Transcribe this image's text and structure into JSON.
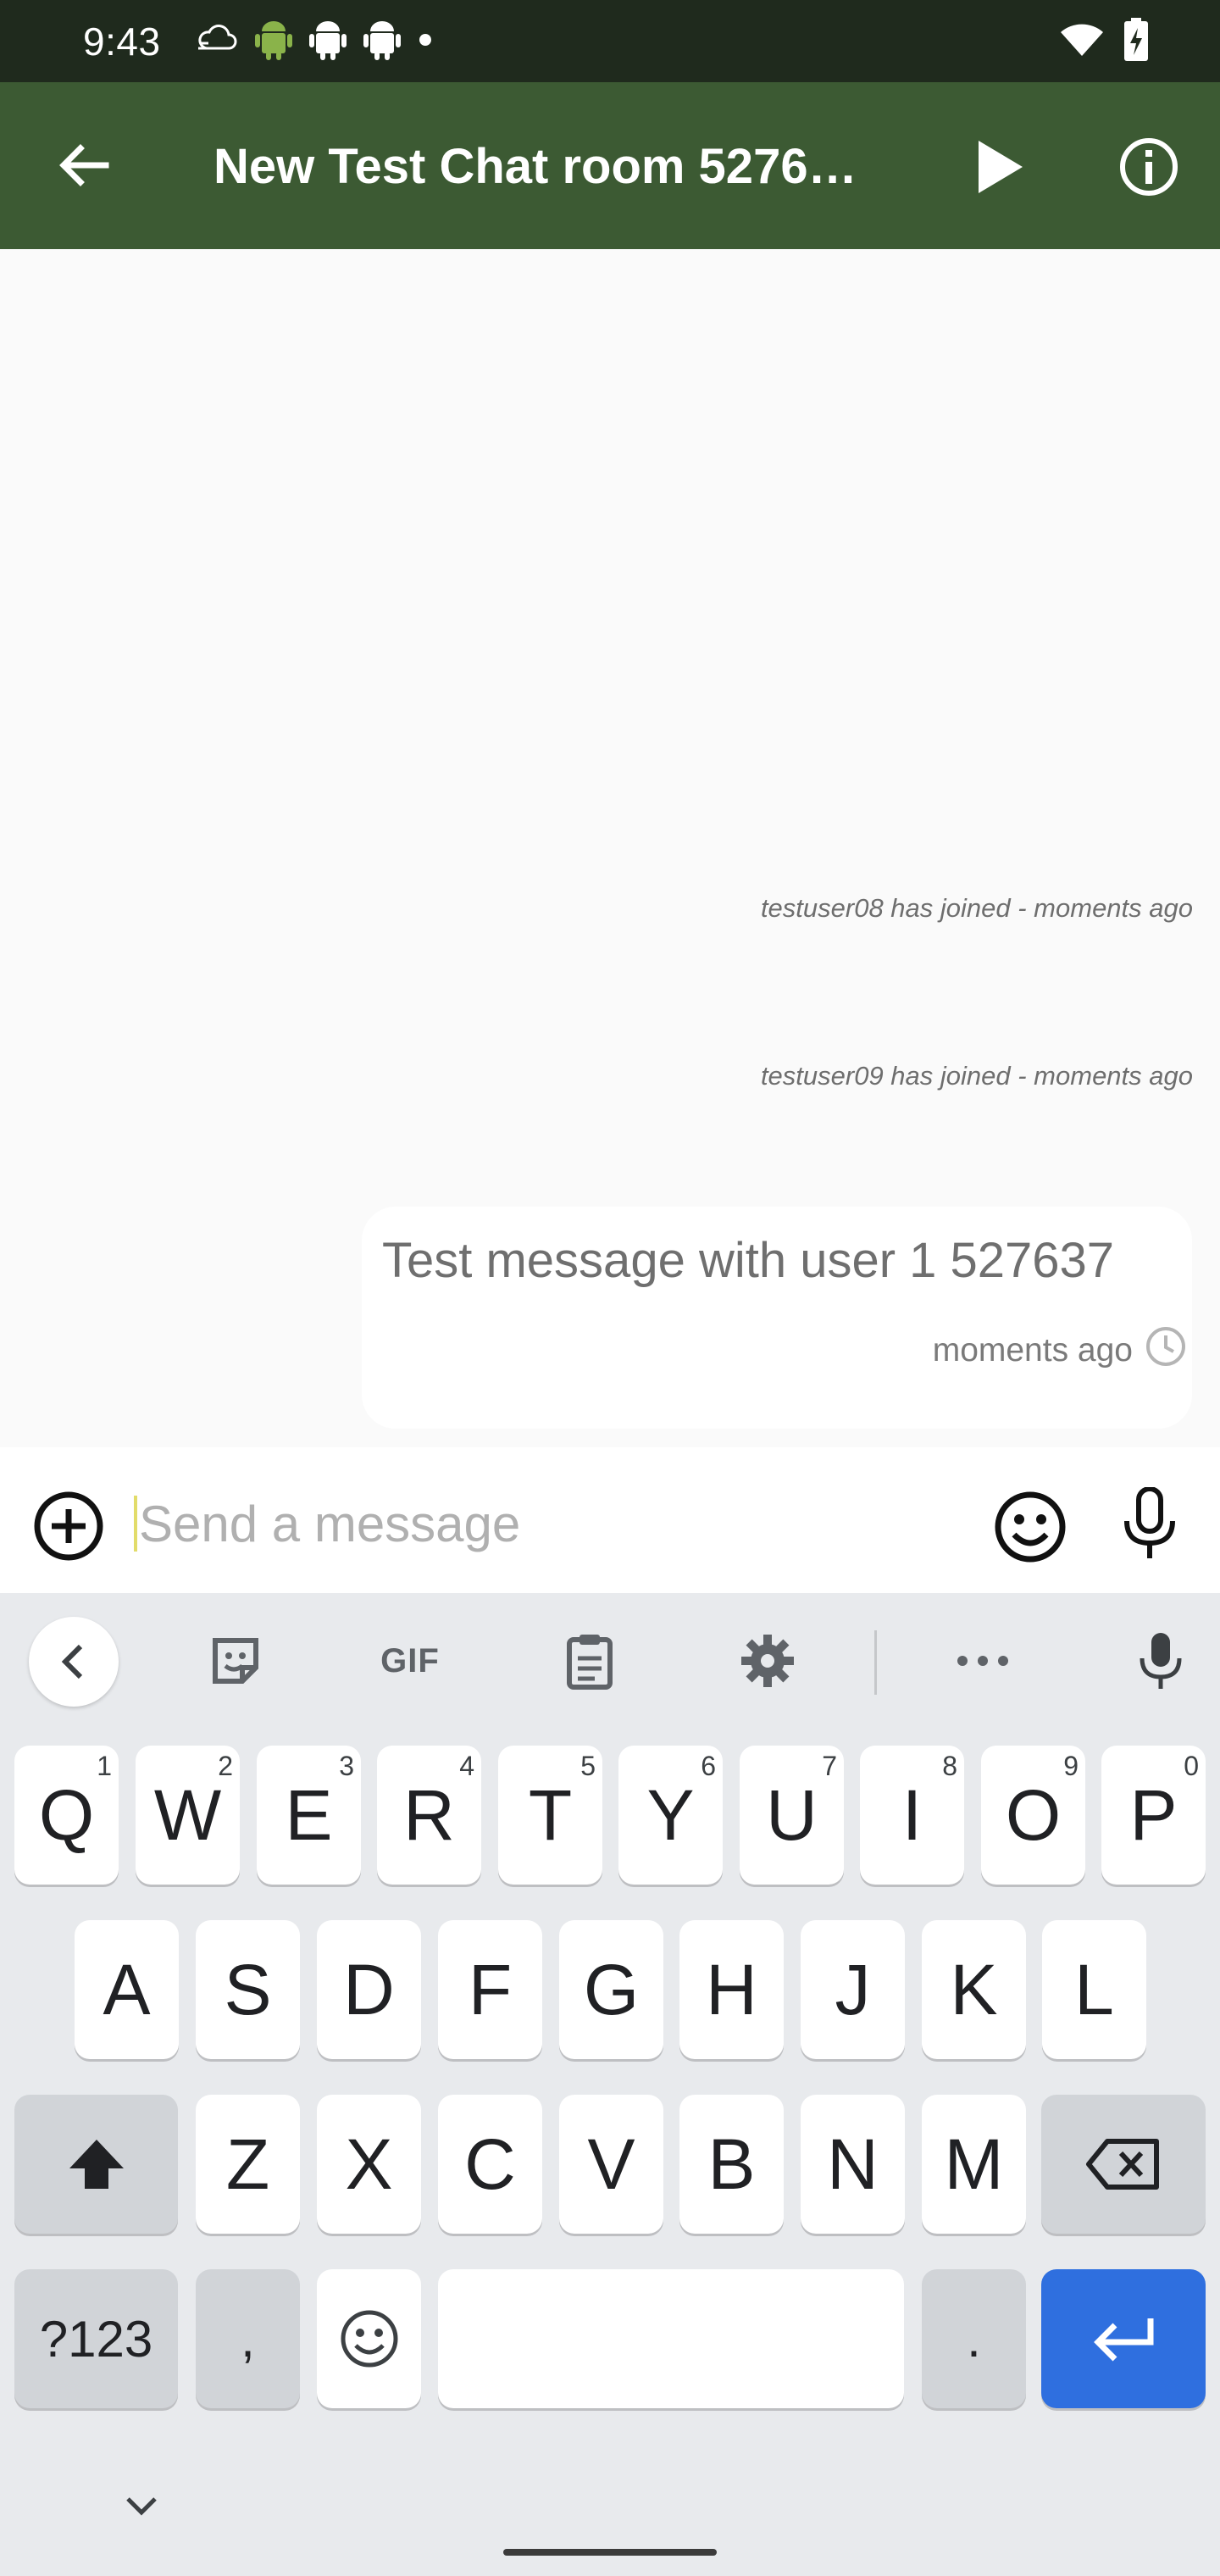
{
  "status_bar": {
    "time": "9:43",
    "left_icons": [
      "cloud-icon",
      "android-icon",
      "android-icon",
      "android-icon",
      "dot-icon"
    ],
    "right_icons": [
      "wifi-icon",
      "battery-charging-icon"
    ]
  },
  "app_bar": {
    "title": "New Test Chat room 5276…",
    "color": "#3c5a33",
    "icons": [
      "back-arrow-icon",
      "play-icon",
      "info-icon"
    ]
  },
  "chat": {
    "system_messages": [
      "testuser08 has joined - moments ago",
      "testuser09 has joined - moments ago"
    ],
    "message": {
      "text": "Test message with user 1 527637",
      "time": "moments ago",
      "status_icon": "clock-icon"
    }
  },
  "composer": {
    "placeholder": "Send a message",
    "value": ""
  },
  "keyboard": {
    "toolbar": {
      "gif_label": "GIF",
      "icons": [
        "chevron-left-icon",
        "sticker-icon",
        "gif-icon",
        "clipboard-icon",
        "settings-icon",
        "more-icon",
        "mic-icon"
      ]
    },
    "row1": [
      {
        "label": "Q",
        "hint": "1"
      },
      {
        "label": "W",
        "hint": "2"
      },
      {
        "label": "E",
        "hint": "3"
      },
      {
        "label": "R",
        "hint": "4"
      },
      {
        "label": "T",
        "hint": "5"
      },
      {
        "label": "Y",
        "hint": "6"
      },
      {
        "label": "U",
        "hint": "7"
      },
      {
        "label": "I",
        "hint": "8"
      },
      {
        "label": "O",
        "hint": "9"
      },
      {
        "label": "P",
        "hint": "0"
      }
    ],
    "row2": [
      "A",
      "S",
      "D",
      "F",
      "G",
      "H",
      "J",
      "K",
      "L"
    ],
    "row3": [
      "Z",
      "X",
      "C",
      "V",
      "B",
      "N",
      "M"
    ],
    "symbols_label": "?123",
    "comma_label": ",",
    "period_label": ".",
    "accent_color": "#2f6fdf"
  }
}
